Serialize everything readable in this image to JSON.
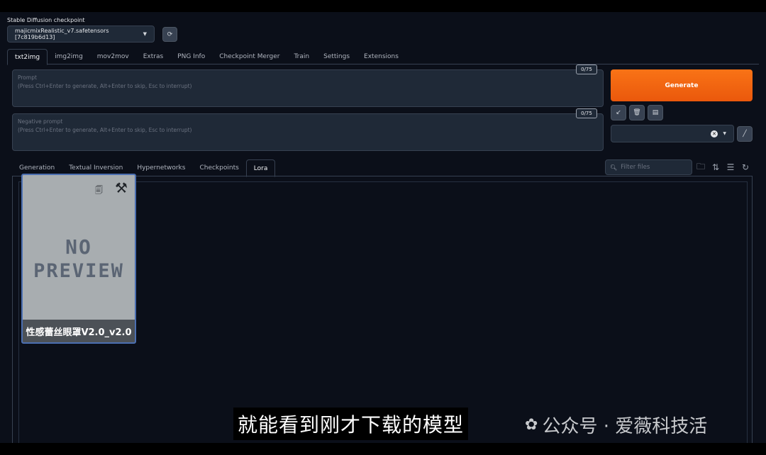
{
  "checkpoint": {
    "label": "Stable Diffusion checkpoint",
    "value": "majicmixRealistic_v7.safetensors [7c819b6d13]"
  },
  "tabs": [
    {
      "label": "txt2img",
      "active": true
    },
    {
      "label": "img2img"
    },
    {
      "label": "mov2mov"
    },
    {
      "label": "Extras"
    },
    {
      "label": "PNG Info"
    },
    {
      "label": "Checkpoint Merger"
    },
    {
      "label": "Train"
    },
    {
      "label": "Settings"
    },
    {
      "label": "Extensions"
    }
  ],
  "prompt": {
    "title": "Prompt",
    "placeholder": "(Press Ctrl+Enter to generate, Alt+Enter to skip, Esc to interrupt)",
    "counter": "0/75"
  },
  "negative_prompt": {
    "title": "Negative prompt",
    "placeholder": "(Press Ctrl+Enter to generate, Alt+Enter to skip, Esc to interrupt)",
    "counter": "0/75"
  },
  "generate_label": "Generate",
  "subtabs": [
    {
      "label": "Generation"
    },
    {
      "label": "Textual Inversion"
    },
    {
      "label": "Hypernetworks"
    },
    {
      "label": "Checkpoints"
    },
    {
      "label": "Lora",
      "active": true
    }
  ],
  "filter": {
    "placeholder": "Filter files"
  },
  "lora_card": {
    "preview_line1": "NO",
    "preview_line2": "PREVIEW",
    "name": "性感蕾丝眼罩V2.0_v2.0"
  },
  "overlay": {
    "subtitle": "就能看到刚才下载的模型",
    "watermark": "公众号 · 爱薇科技活"
  },
  "colors": {
    "generate": "#f97316",
    "background": "#0b0f19",
    "card_border": "#4b6fb1"
  }
}
